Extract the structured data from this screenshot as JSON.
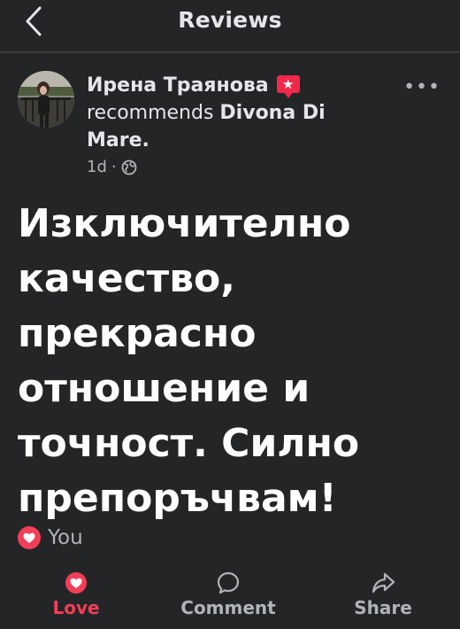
{
  "header": {
    "title": "Reviews",
    "back_icon": "chevron-left-icon"
  },
  "post": {
    "author_name": "Ирена Траянова",
    "badge_icon": "star-badge-icon",
    "badge_glyph": "★",
    "verb": "recommends",
    "place_name": "Divona Di Mare",
    "place_suffix": ".",
    "time_ago": "1d",
    "separator": "·",
    "privacy_icon": "globe-icon",
    "more_label": "•••",
    "review_text": "Изключително качество, прекрасно отношение и точност. Силно препоръчвам!",
    "reactions": {
      "icon": "love-reaction-icon",
      "label": "You"
    }
  },
  "actions": [
    {
      "label": "Love",
      "icon": "love-icon",
      "active": true,
      "color": "#f33e58"
    },
    {
      "label": "Comment",
      "icon": "comment-icon",
      "active": false
    },
    {
      "label": "Share",
      "icon": "share-icon",
      "active": false
    }
  ],
  "colors": {
    "background": "#242526",
    "text_primary": "#e4e6eb",
    "text_secondary": "#b0b3b8",
    "love": "#f33e58",
    "badge": "#f0284a"
  }
}
